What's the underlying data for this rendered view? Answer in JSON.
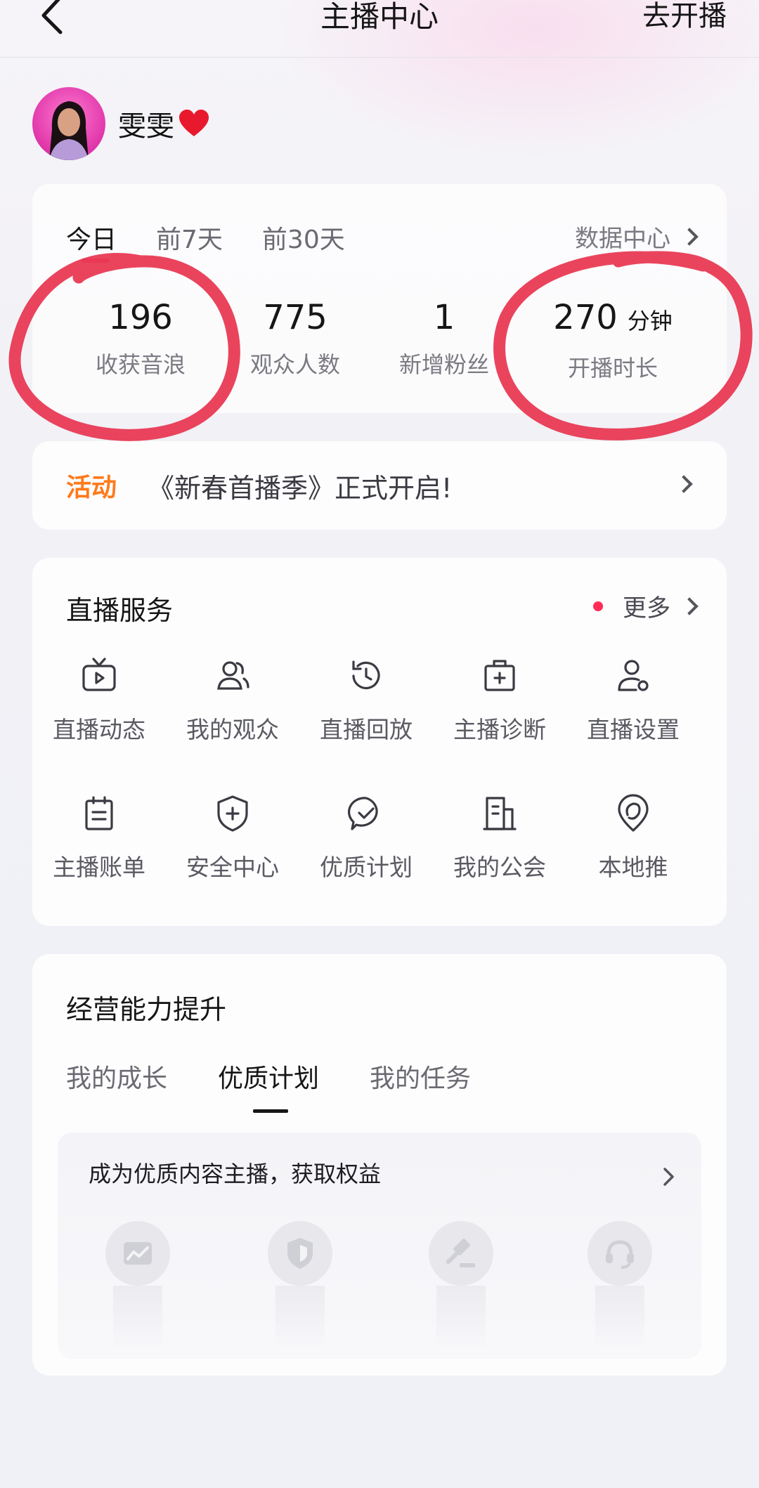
{
  "header": {
    "title": "主播中心",
    "action_label": "去开播"
  },
  "profile": {
    "name": "雯雯"
  },
  "stats": {
    "periods": [
      "今日",
      "前7天",
      "前30天"
    ],
    "active_period": "今日",
    "data_center_label": "数据中心",
    "items": [
      {
        "value": "196",
        "unit": "",
        "label": "收获音浪"
      },
      {
        "value": "775",
        "unit": "",
        "label": "观众人数"
      },
      {
        "value": "1",
        "unit": "",
        "label": "新增粉丝"
      },
      {
        "value": "270",
        "unit": "分钟",
        "label": "开播时长"
      }
    ]
  },
  "event": {
    "tag": "活动",
    "text": "《新春首播季》正式开启!"
  },
  "services": {
    "title": "直播服务",
    "more_label": "更多",
    "items": [
      {
        "label": "直播动态",
        "icon": "tv-play-icon"
      },
      {
        "label": "我的观众",
        "icon": "users-icon"
      },
      {
        "label": "直播回放",
        "icon": "replay-clock-icon"
      },
      {
        "label": "主播诊断",
        "icon": "medical-kit-icon"
      },
      {
        "label": "直播设置",
        "icon": "user-settings-icon"
      },
      {
        "label": "主播账单",
        "icon": "clipboard-icon"
      },
      {
        "label": "安全中心",
        "icon": "shield-plus-icon"
      },
      {
        "label": "优质计划",
        "icon": "check-badge-icon"
      },
      {
        "label": "我的公会",
        "icon": "building-icon"
      },
      {
        "label": "本地推",
        "icon": "location-pin-icon"
      }
    ]
  },
  "growth": {
    "title": "经营能力提升",
    "tabs": [
      "我的成长",
      "优质计划",
      "我的任务"
    ],
    "active_tab": "优质计划",
    "banner_text": "成为优质内容主播，获取权益",
    "benefits": [
      "trend-chart-icon",
      "shield-icon",
      "gavel-icon",
      "headset-icon"
    ]
  },
  "colors": {
    "accent": "#fe2c55",
    "event_tag": "#ff7a1a",
    "annotation_circle": "#e8344f"
  }
}
